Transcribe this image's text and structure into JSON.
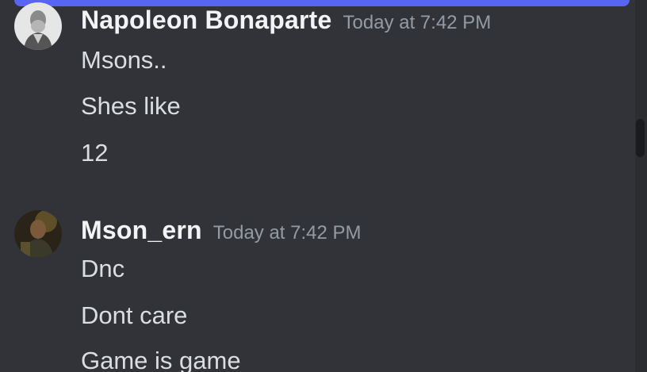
{
  "messages": [
    {
      "author": "Napoleon Bonaparte",
      "avatar_icon": "statue-portrait-avatar",
      "timestamp": "Today at 7:42 PM",
      "lines": [
        "Msons..",
        "Shes like",
        "12"
      ]
    },
    {
      "author": "Mson_ern",
      "avatar_icon": "dark-portrait-avatar",
      "timestamp": "Today at 7:42 PM",
      "lines": [
        "Dnc",
        "Dont care",
        "Game is game"
      ]
    }
  ],
  "colors": {
    "background": "#313338",
    "accent_bar": "#5865f2",
    "username": "#f2f3f5",
    "timestamp": "#949ba4",
    "message_text": "#dbdee1"
  }
}
